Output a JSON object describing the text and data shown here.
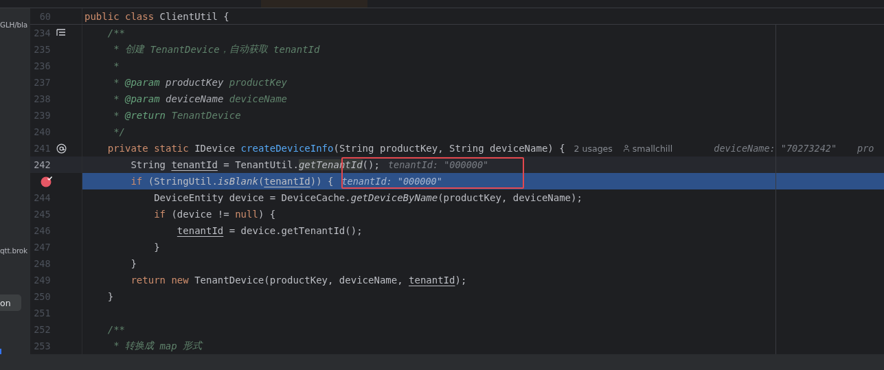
{
  "sidebar": {
    "items": [
      {
        "kind": "text",
        "label": "GLH/bla"
      },
      {
        "kind": "text",
        "label": "qtt.brok"
      },
      {
        "kind": "button",
        "label": "on"
      }
    ]
  },
  "sticky_header": {
    "number": "60",
    "segments": [
      {
        "kind": "keyword",
        "text": "public class "
      },
      {
        "kind": "text",
        "text": "ClientUtil {"
      }
    ]
  },
  "lines": [
    {
      "number": "234",
      "kind": "hierarchy",
      "current": false,
      "execution_point": false,
      "breakpoint": false,
      "segments": [
        {
          "kind": "comment",
          "text": "    /**"
        }
      ]
    },
    {
      "number": "235",
      "kind": "plain",
      "current": false,
      "execution_point": false,
      "breakpoint": false,
      "segments": [
        {
          "kind": "comment",
          "text": "     * 创建 "
        },
        {
          "kind": "doc_ref",
          "text": "TenantDevice"
        },
        {
          "kind": "comment",
          "text": "，自动获取 "
        },
        {
          "kind": "doc_ref",
          "text": "tenantId"
        }
      ]
    },
    {
      "number": "236",
      "kind": "plain",
      "current": false,
      "execution_point": false,
      "breakpoint": false,
      "segments": [
        {
          "kind": "comment",
          "text": "     *"
        }
      ]
    },
    {
      "number": "237",
      "kind": "plain",
      "current": false,
      "execution_point": false,
      "breakpoint": false,
      "segments": [
        {
          "kind": "comment",
          "text": "     * "
        },
        {
          "kind": "doc_tag",
          "text": "@param"
        },
        {
          "kind": "doc_param",
          "text": " productKey"
        },
        {
          "kind": "doc_ref",
          "text": " productKey"
        }
      ]
    },
    {
      "number": "238",
      "kind": "plain",
      "current": false,
      "execution_point": false,
      "breakpoint": false,
      "segments": [
        {
          "kind": "comment",
          "text": "     * "
        },
        {
          "kind": "doc_tag",
          "text": "@param"
        },
        {
          "kind": "doc_param",
          "text": " deviceName"
        },
        {
          "kind": "doc_ref",
          "text": " deviceName"
        }
      ]
    },
    {
      "number": "239",
      "kind": "plain",
      "current": false,
      "execution_point": false,
      "breakpoint": false,
      "segments": [
        {
          "kind": "comment",
          "text": "     * "
        },
        {
          "kind": "doc_tag",
          "text": "@return"
        },
        {
          "kind": "doc_ref",
          "text": " TenantDevice"
        }
      ]
    },
    {
      "number": "240",
      "kind": "plain",
      "current": false,
      "execution_point": false,
      "breakpoint": false,
      "segments": [
        {
          "kind": "comment",
          "text": "     */"
        }
      ]
    },
    {
      "number": "241",
      "kind": "at",
      "current": false,
      "execution_point": false,
      "breakpoint": false,
      "segments": [
        {
          "kind": "keyword",
          "text": "    private static "
        },
        {
          "kind": "text",
          "text": "IDevice "
        },
        {
          "kind": "function",
          "text": "createDeviceInfo"
        },
        {
          "kind": "text",
          "text": "(String productKey, String deviceName) {"
        },
        {
          "kind": "usages",
          "text": "2 usages"
        },
        {
          "kind": "author",
          "text": "smallchill"
        },
        {
          "kind": "debug_value",
          "text": "deviceName: \"70273242\""
        },
        {
          "kind": "debug_value",
          "text": "pro"
        }
      ]
    },
    {
      "number": "242",
      "kind": "plain",
      "current": true,
      "execution_point": false,
      "breakpoint": false,
      "segments": [
        {
          "kind": "text",
          "text": "        String "
        },
        {
          "kind": "variable",
          "text": "tenantId"
        },
        {
          "kind": "text",
          "text": " = TenantUtil."
        },
        {
          "kind": "method_hover",
          "text": "getTenantId"
        },
        {
          "kind": "text",
          "text": "();"
        },
        {
          "kind": "debug_value",
          "text": "tenantId: \"000000\""
        }
      ]
    },
    {
      "current": false,
      "execution_point": true,
      "breakpoint": true,
      "segments": [
        {
          "kind": "keyword",
          "text": "        if "
        },
        {
          "kind": "text",
          "text": "(StringUtil."
        },
        {
          "kind": "method",
          "text": "isBlank"
        },
        {
          "kind": "text",
          "text": "("
        },
        {
          "kind": "variable",
          "text": "tenantId"
        },
        {
          "kind": "text",
          "text": ")) {"
        },
        {
          "kind": "debug_value",
          "text": "tenantId: \"000000\""
        }
      ]
    },
    {
      "number": "244",
      "kind": "plain",
      "current": false,
      "execution_point": false,
      "breakpoint": false,
      "segments": [
        {
          "kind": "text",
          "text": "            DeviceEntity device = DeviceCache."
        },
        {
          "kind": "method",
          "text": "getDeviceByName"
        },
        {
          "kind": "text",
          "text": "(productKey, deviceName);"
        }
      ]
    },
    {
      "number": "245",
      "kind": "plain",
      "current": false,
      "execution_point": false,
      "breakpoint": false,
      "segments": [
        {
          "kind": "keyword",
          "text": "            if "
        },
        {
          "kind": "text",
          "text": "(device != "
        },
        {
          "kind": "keyword",
          "text": "null"
        },
        {
          "kind": "text",
          "text": ") {"
        }
      ]
    },
    {
      "number": "246",
      "kind": "plain",
      "current": false,
      "execution_point": false,
      "breakpoint": false,
      "segments": [
        {
          "kind": "variable",
          "text": "                tenantId"
        },
        {
          "kind": "text",
          "text": " = device.getTenantId();"
        }
      ]
    },
    {
      "number": "247",
      "kind": "plain",
      "current": false,
      "execution_point": false,
      "breakpoint": false,
      "segments": [
        {
          "kind": "text",
          "text": "            }"
        }
      ]
    },
    {
      "number": "248",
      "kind": "plain",
      "current": false,
      "execution_point": false,
      "breakpoint": false,
      "segments": [
        {
          "kind": "text",
          "text": "        }"
        }
      ]
    },
    {
      "number": "249",
      "kind": "plain",
      "current": false,
      "execution_point": false,
      "breakpoint": false,
      "segments": [
        {
          "kind": "keyword",
          "text": "        return new "
        },
        {
          "kind": "text",
          "text": "TenantDevice(productKey, deviceName, "
        },
        {
          "kind": "variable",
          "text": "tenantId"
        },
        {
          "kind": "text",
          "text": ");"
        }
      ]
    },
    {
      "number": "250",
      "kind": "plain",
      "current": false,
      "execution_point": false,
      "breakpoint": false,
      "segments": [
        {
          "kind": "text",
          "text": "    }"
        }
      ]
    },
    {
      "number": "251",
      "kind": "plain",
      "current": false,
      "execution_point": false,
      "breakpoint": false
    },
    {
      "number": "252",
      "kind": "plain",
      "current": false,
      "execution_point": false,
      "breakpoint": false,
      "segments": [
        {
          "kind": "comment",
          "text": "    /**"
        }
      ]
    },
    {
      "number": "253",
      "kind": "plain",
      "current": false,
      "execution_point": false,
      "breakpoint": false,
      "segments": [
        {
          "kind": "comment",
          "text": "     * 转换成 "
        },
        {
          "kind": "doc_ref",
          "text": "map"
        },
        {
          "kind": "comment",
          "text": " 形式"
        }
      ]
    }
  ]
}
